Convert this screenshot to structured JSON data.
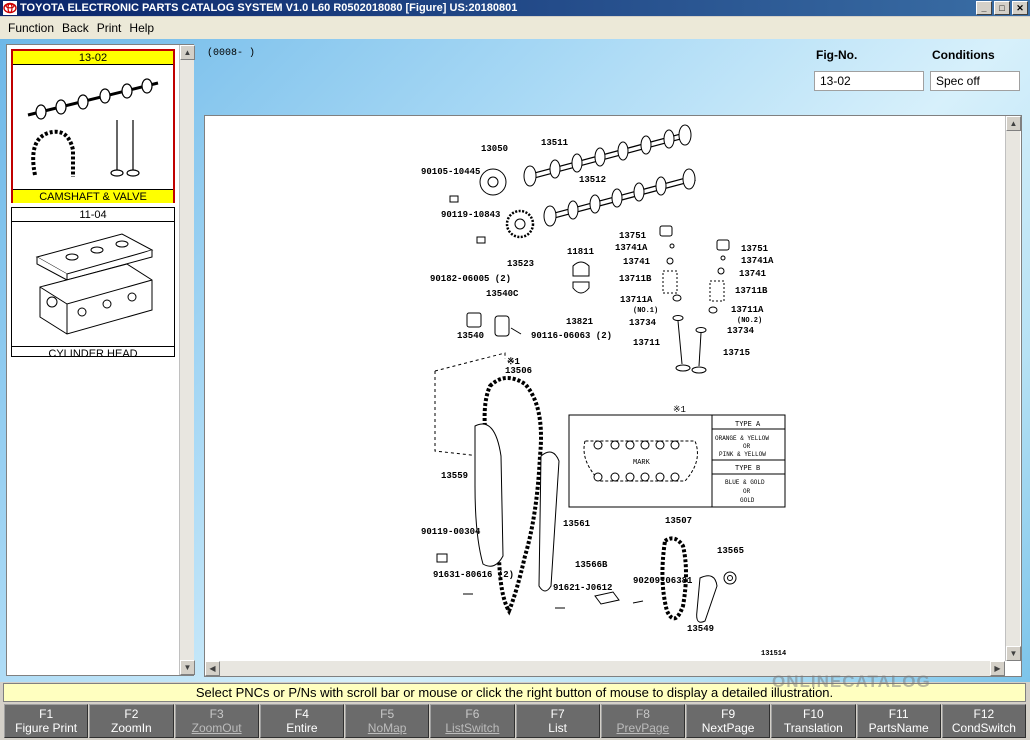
{
  "window": {
    "title": "TOYOTA ELECTRONIC PARTS CATALOG SYSTEM V1.0 L60 R0502018080 [Figure] US:20180801"
  },
  "menu": [
    "Function",
    "Back",
    "Print",
    "Help"
  ],
  "thumbnails": [
    {
      "code": "13-02",
      "name": "CAMSHAFT & VALVE",
      "selected": true
    },
    {
      "code": "11-04",
      "name": "CYLINDER HEAD",
      "selected": false
    }
  ],
  "coords": "(0008-       )",
  "fig": {
    "label": "Fig-No.",
    "value": "13-02"
  },
  "conditions": {
    "label": "Conditions",
    "value": "Spec off"
  },
  "diagram": {
    "labels": [
      "13050",
      "13511",
      "13512",
      "90105-10445",
      "90119-10843",
      "13523",
      "11811",
      "13751",
      "13741A",
      "13741",
      "13711B",
      "13711A",
      "(NO.1)",
      "13734",
      "13711",
      "13751",
      "13741A",
      "13741",
      "13711B",
      "13711A",
      "(NO.2)",
      "13734",
      "13715",
      "90182-06005 (2)",
      "13540C",
      "13540",
      "90116-06063 (2)",
      "13821",
      "※1",
      "13506",
      "13559",
      "13561",
      "90119-00304",
      "91631-80616 (2)",
      "13566B",
      "91621-J0612",
      "13507",
      "90209-06381",
      "13565",
      "13549",
      "131514"
    ],
    "inset": {
      "marker": "※1",
      "mark_label": "MARK",
      "type_a": "TYPE A",
      "type_a_desc": [
        "ORANGE & YELLOW",
        "OR",
        "PINK & YELLOW"
      ],
      "type_b": "TYPE B",
      "type_b_desc": [
        "BLUE & GOLD",
        "OR",
        "GOLD"
      ]
    }
  },
  "status": "Select PNCs or P/Ns with scroll bar or mouse or click the right button of mouse to display a detailed illustration.",
  "fkeys": [
    {
      "key": "F1",
      "label": "Figure Print",
      "enabled": true
    },
    {
      "key": "F2",
      "label": "ZoomIn",
      "enabled": true
    },
    {
      "key": "F3",
      "label": "ZoomOut",
      "enabled": false
    },
    {
      "key": "F4",
      "label": "Entire",
      "enabled": true
    },
    {
      "key": "F5",
      "label": "NoMap",
      "enabled": false
    },
    {
      "key": "F6",
      "label": "ListSwitch",
      "enabled": false
    },
    {
      "key": "F7",
      "label": "List",
      "enabled": true
    },
    {
      "key": "F8",
      "label": "PrevPage",
      "enabled": false
    },
    {
      "key": "F9",
      "label": "NextPage",
      "enabled": true
    },
    {
      "key": "F10",
      "label": "Translation",
      "enabled": true
    },
    {
      "key": "F11",
      "label": "PartsName",
      "enabled": true
    },
    {
      "key": "F12",
      "label": "CondSwitch",
      "enabled": true
    }
  ],
  "watermark": "ONLINECATALOG"
}
